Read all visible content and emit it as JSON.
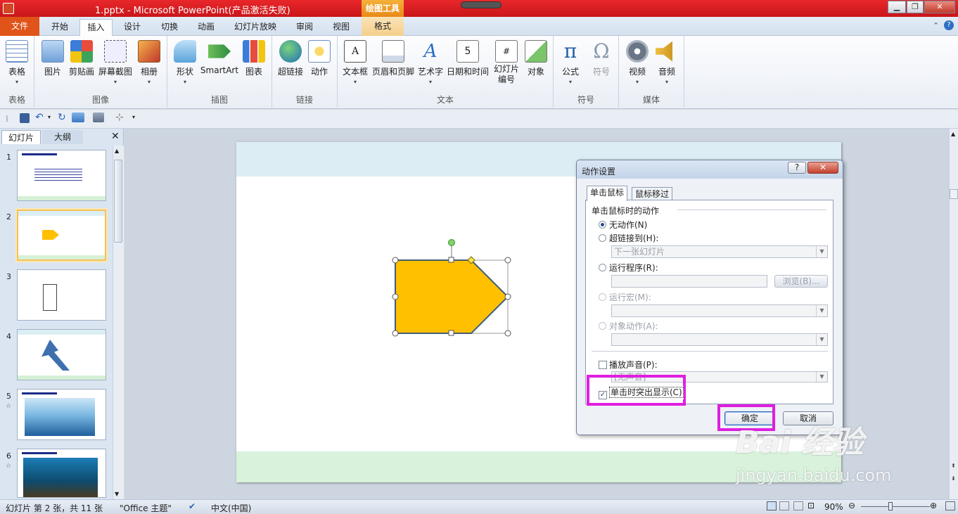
{
  "window": {
    "title": "1.pptx  -  Microsoft PowerPoint(产品激活失败)",
    "contextual_tab": "绘图工具"
  },
  "tabs": [
    "文件",
    "开始",
    "插入",
    "设计",
    "切换",
    "动画",
    "幻灯片放映",
    "审阅",
    "视图",
    "格式"
  ],
  "ribbon": {
    "groups": [
      "表格",
      "图像",
      "插图",
      "链接",
      "文本",
      "符号",
      "媒体"
    ],
    "buttons": [
      "表格",
      "图片",
      "剪贴画",
      "屏幕截图",
      "相册",
      "形状",
      "SmartArt",
      "图表",
      "超链接",
      "动作",
      "文本框",
      "页眉和页脚",
      "艺术字",
      "日期和时间",
      "幻灯片\n编号",
      "对象",
      "公式",
      "符号",
      "视频",
      "音频"
    ]
  },
  "panel": {
    "tabs": [
      "幻灯片",
      "大纲"
    ],
    "slide_numbers": [
      "1",
      "2",
      "3",
      "4",
      "5",
      "6"
    ],
    "selected": 2
  },
  "dialog": {
    "title": "动作设置",
    "tabs": [
      "单击鼠标",
      "鼠标移过"
    ],
    "section": "单击鼠标时的动作",
    "options": [
      "无动作(N)",
      "超链接到(H):",
      "运行程序(R):",
      "运行宏(M):",
      "对象动作(A):"
    ],
    "hyperlink_value": "下一张幻灯片",
    "browse": "浏览(B)...",
    "play_sound": "播放声音(P):",
    "sound_value": "[无声音]",
    "highlight_click": "单击时突出显示(C)",
    "ok": "确定",
    "cancel": "取消"
  },
  "status": {
    "slide_info": "幻灯片 第 2 张，共 11 张",
    "theme": "\"Office 主题\"",
    "language": "中文(中国)",
    "zoom": "90%"
  },
  "watermark": {
    "brand": "Bai 经验",
    "url": "jingyan.baidu.com"
  },
  "colors": {
    "accent": "#e0541a",
    "highlight": "#e01ee0",
    "shape_fill": "#ffc000"
  }
}
